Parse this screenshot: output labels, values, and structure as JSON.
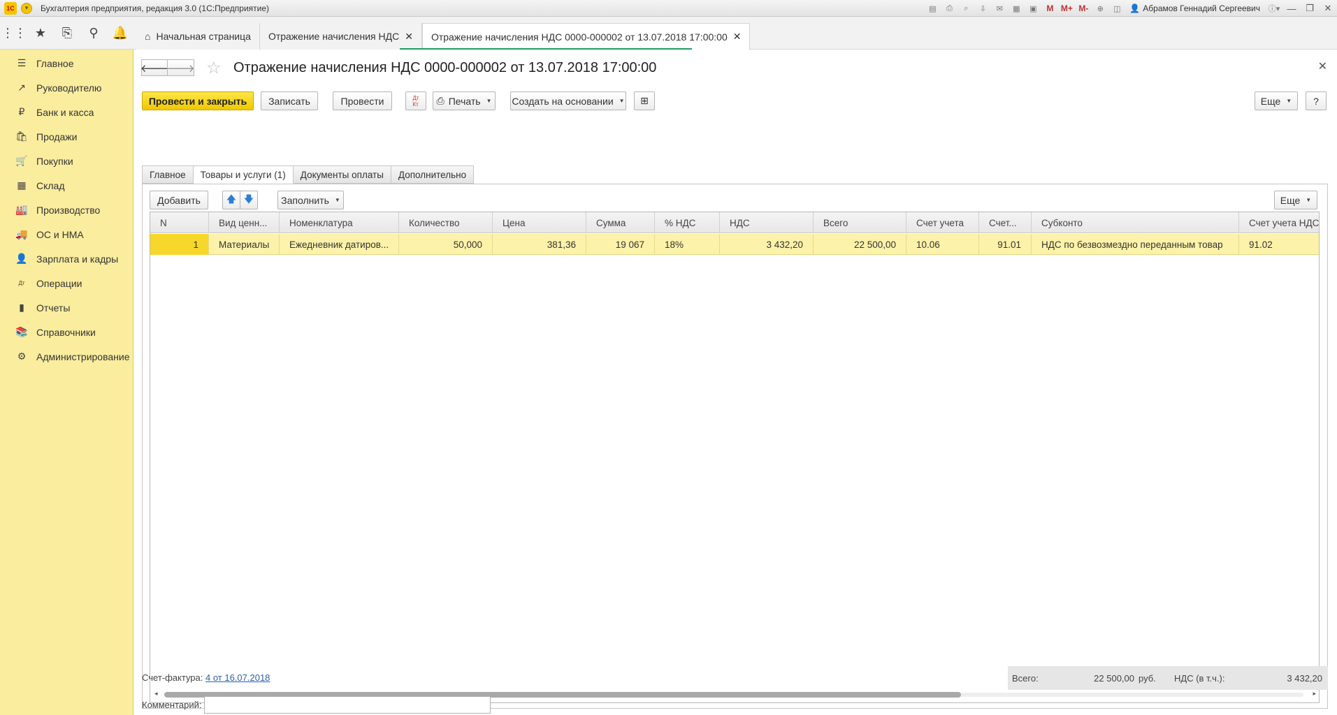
{
  "app": {
    "window_title": "Бухгалтерия предприятия, редакция 3.0  (1С:Предприятие)",
    "logo_text": "1С",
    "user": "Абрамов Геннадий Сергеевич",
    "memory_buttons": [
      "M",
      "M+",
      "M-"
    ]
  },
  "top_tabs": [
    {
      "label": "Начальная страница"
    },
    {
      "label": "Отражение начисления НДС"
    },
    {
      "label": "Отражение начисления НДС 0000-000002 от 13.07.2018 17:00:00"
    }
  ],
  "sidebar": {
    "items": [
      {
        "label": "Главное",
        "icon": "menu-lines-icon"
      },
      {
        "label": "Руководителю",
        "icon": "trend-icon"
      },
      {
        "label": "Банк и касса",
        "icon": "ruble-coin-icon"
      },
      {
        "label": "Продажи",
        "icon": "shopping-bag-icon"
      },
      {
        "label": "Покупки",
        "icon": "cart-icon"
      },
      {
        "label": "Склад",
        "icon": "warehouse-grid-icon"
      },
      {
        "label": "Производство",
        "icon": "factory-icon"
      },
      {
        "label": "ОС и НМА",
        "icon": "truck-icon"
      },
      {
        "label": "Зарплата и кадры",
        "icon": "person-icon"
      },
      {
        "label": "Операции",
        "icon": "dt-kt-icon"
      },
      {
        "label": "Отчеты",
        "icon": "bar-chart-icon"
      },
      {
        "label": "Справочники",
        "icon": "books-icon"
      },
      {
        "label": "Администрирование",
        "icon": "gear-icon"
      }
    ]
  },
  "form": {
    "title": "Отражение начисления НДС 0000-000002 от 13.07.2018 17:00:00",
    "toolbar": {
      "post_and_close": "Провести и закрыть",
      "save": "Записать",
      "post": "Провести",
      "print": "Печать",
      "create_based_on": "Создать на основании",
      "more": "Еще",
      "help": "?"
    },
    "tabs": [
      "Главное",
      "Товары и услуги (1)",
      "Документы оплаты",
      "Дополнительно"
    ],
    "table_toolbar": {
      "add": "Добавить",
      "fill": "Заполнить",
      "more": "Еще"
    },
    "table": {
      "columns": [
        "N",
        "Вид ценн...",
        "Номенклатура",
        "Количество",
        "Цена",
        "Сумма",
        "% НДС",
        "НДС",
        "Всего",
        "Счет учета",
        "Счет...",
        "Субконто",
        "Счет учета НДС"
      ],
      "rows": [
        [
          "1",
          "Материалы",
          "Ежедневник датиров...",
          "50,000",
          "381,36",
          "19 067",
          "18%",
          "3 432,20",
          "22 500,00",
          "10.06",
          "91.01",
          "НДС по безвозмездно переданным товар",
          "91.02"
        ]
      ]
    },
    "footer": {
      "invoice_label": "Счет-фактура:",
      "invoice_link": "4 от 16.07.2018",
      "comment_label": "Комментарий:",
      "comment_value": "",
      "total_label": "Всего:",
      "total_value": "22 500,00",
      "currency": "руб.",
      "vat_label": "НДС (в т.ч.):",
      "vat_value": "3 432,20"
    }
  }
}
